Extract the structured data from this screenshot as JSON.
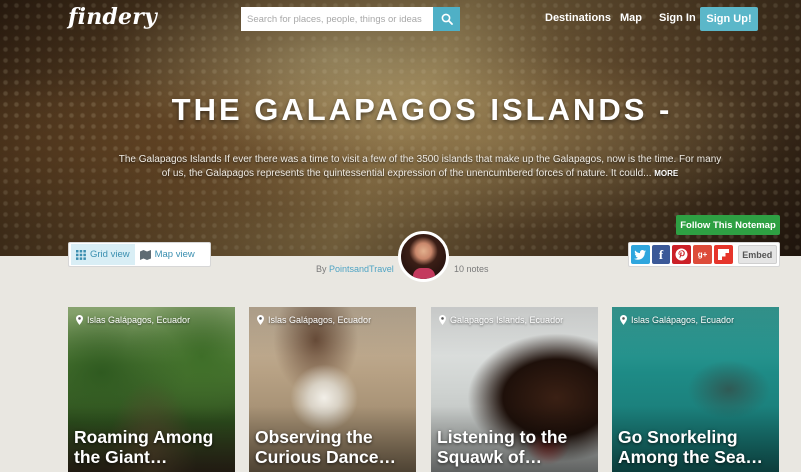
{
  "nav": {
    "logo": "findery",
    "search_placeholder": "Search for places, people, things or ideas",
    "links": [
      "Destinations",
      "Map",
      "Sign In"
    ],
    "signup": "Sign Up!"
  },
  "hero": {
    "title": "THE GALAPAGOS ISLANDS -",
    "description": "The Galapagos Islands If ever there was a time to visit a few of the 3500 islands that make up the Galapagos, now is the time. For many of us, the Galapagos represents the quintessential expression of the unencumbered forces of nature. It could...",
    "more": "MORE",
    "follow": "Follow This Notemap"
  },
  "views": {
    "grid": "Grid view",
    "map": "Map view"
  },
  "author": {
    "by": "By",
    "name": "PointsandTravel",
    "notes": "10 notes"
  },
  "share": {
    "embed": "Embed"
  },
  "cards": [
    {
      "location": "Islas Galápagos, Ecuador",
      "title": "Roaming Among the Giant…"
    },
    {
      "location": "Islas Galápagos, Ecuador",
      "title": "Observing the Curious Dance…"
    },
    {
      "location": "Galapagos Islands, Ecuador",
      "title": "Listening to the Squawk of…"
    },
    {
      "location": "Islas Galápagos, Ecuador",
      "title": "Go Snorkeling Among the Sea…"
    }
  ],
  "colors": {
    "accent": "#4fb0c6",
    "follow": "#2ea043",
    "link": "#4fa4c4"
  }
}
